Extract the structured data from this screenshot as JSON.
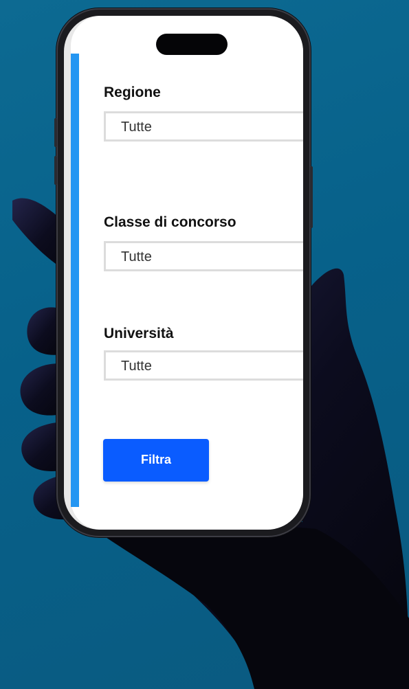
{
  "form": {
    "region": {
      "label": "Regione",
      "value": "Tutte"
    },
    "competition_class": {
      "label": "Classe di concorso",
      "value": "Tutte"
    },
    "university": {
      "label": "Università",
      "value": "Tutte"
    },
    "filter_button": {
      "label": "Filtra"
    }
  },
  "colors": {
    "background": "#07618a",
    "accent_bar": "#2496f2",
    "button": "#0a5cff"
  }
}
